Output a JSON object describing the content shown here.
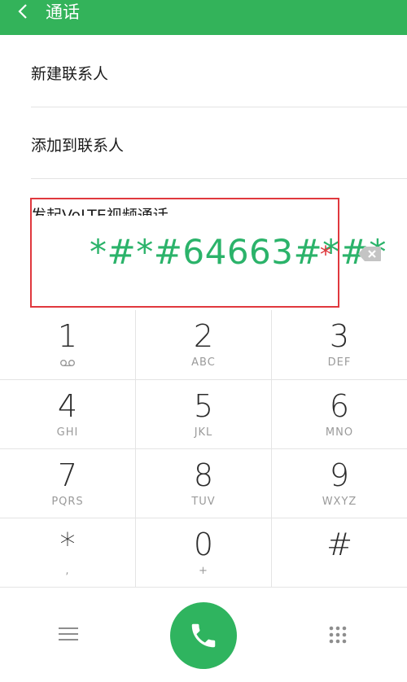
{
  "header": {
    "title": "通话",
    "back_icon": "chevron-left-icon"
  },
  "menu": {
    "items": [
      {
        "label": "新建联系人"
      },
      {
        "label": "添加到联系人"
      },
      {
        "label": "发起VoLTE视频通话"
      }
    ]
  },
  "dialer": {
    "number": "*#*#64663#*#*",
    "annotation_mark": "*",
    "backspace_icon": "backspace-icon"
  },
  "keypad": {
    "keys": [
      {
        "digit": "1",
        "letters": ""
      },
      {
        "digit": "2",
        "letters": "ABC"
      },
      {
        "digit": "3",
        "letters": "DEF"
      },
      {
        "digit": "4",
        "letters": "GHI"
      },
      {
        "digit": "5",
        "letters": "JKL"
      },
      {
        "digit": "6",
        "letters": "MNO"
      },
      {
        "digit": "7",
        "letters": "PQRS"
      },
      {
        "digit": "8",
        "letters": "TUV"
      },
      {
        "digit": "9",
        "letters": "WXYZ"
      },
      {
        "digit": "*",
        "letters": ","
      },
      {
        "digit": "0",
        "letters": "+"
      },
      {
        "digit": "#",
        "letters": ""
      }
    ]
  },
  "bottom": {
    "menu_icon": "menu-icon",
    "call_icon": "phone-icon",
    "dialpad_icon": "dialpad-icon"
  },
  "colors": {
    "accent": "#33b35a",
    "number_text": "#2bb36a",
    "highlight": "#e0383e"
  }
}
